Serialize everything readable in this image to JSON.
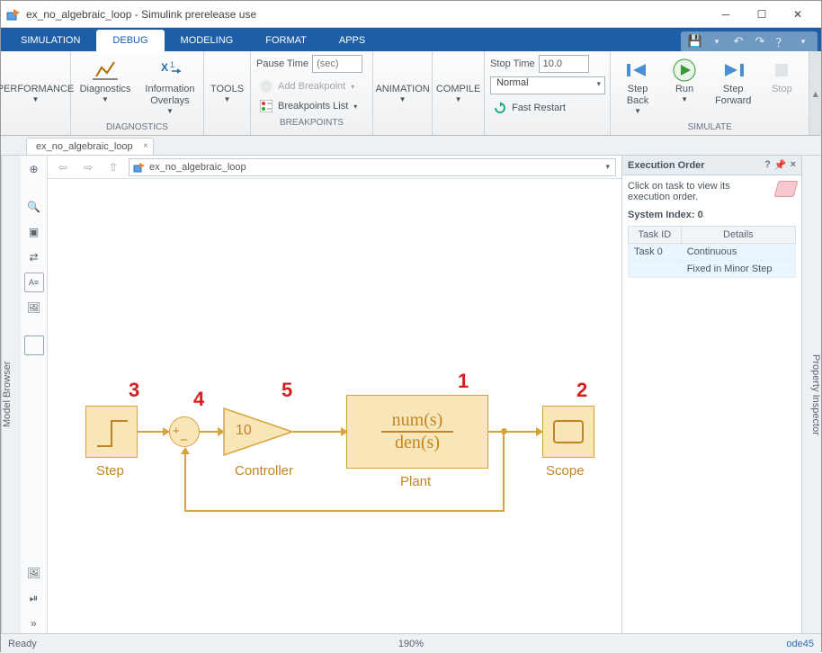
{
  "window": {
    "title": "ex_no_algebraic_loop - Simulink prerelease use"
  },
  "tabs": {
    "simulation": "SIMULATION",
    "debug": "DEBUG",
    "modeling": "MODELING",
    "format": "FORMAT",
    "apps": "APPS"
  },
  "toolstrip": {
    "performance": "PERFORMANCE",
    "diagnostics": "Diagnostics",
    "info_overlays": "Information\nOverlays",
    "tools": "TOOLS",
    "group_diag": "DIAGNOSTICS",
    "pause_time_lbl": "Pause Time",
    "pause_time_ph": "(sec)",
    "add_bp": "Add Breakpoint",
    "bp_list": "Breakpoints List",
    "group_bp": "BREAKPOINTS",
    "animation": "ANIMATION",
    "compile": "COMPILE",
    "stop_time_lbl": "Stop Time",
    "stop_time_val": "10.0",
    "mode": "Normal",
    "fast_restart": "Fast Restart",
    "step_back": "Step\nBack",
    "run": "Run",
    "step_fwd": "Step\nForward",
    "stop": "Stop",
    "group_sim": "SIMULATE"
  },
  "doc": {
    "tabname": "ex_no_algebraic_loop",
    "path": "ex_no_algebraic_loop"
  },
  "left_sidebar": "Model Browser",
  "right_sidebar": "Property Inspector",
  "exec": {
    "title": "Execution Order",
    "hint": "Click on task to view its execution order.",
    "sysidx": "System Index: 0",
    "col_task": "Task ID",
    "col_det": "Details",
    "rows": [
      {
        "id": "Task 0",
        "d": "Continuous"
      },
      {
        "id": "",
        "d": "Fixed in Minor Step"
      }
    ]
  },
  "blocks": {
    "step": "Step",
    "controller": "Controller",
    "plant": "Plant",
    "scope": "Scope",
    "gain": "10",
    "tf_num": "num(s)",
    "tf_den": "den(s)"
  },
  "order": {
    "b1": "1",
    "b2": "2",
    "b3": "3",
    "b4": "4",
    "b5": "5"
  },
  "status": {
    "ready": "Ready",
    "zoom": "190%",
    "solver": "ode45"
  }
}
